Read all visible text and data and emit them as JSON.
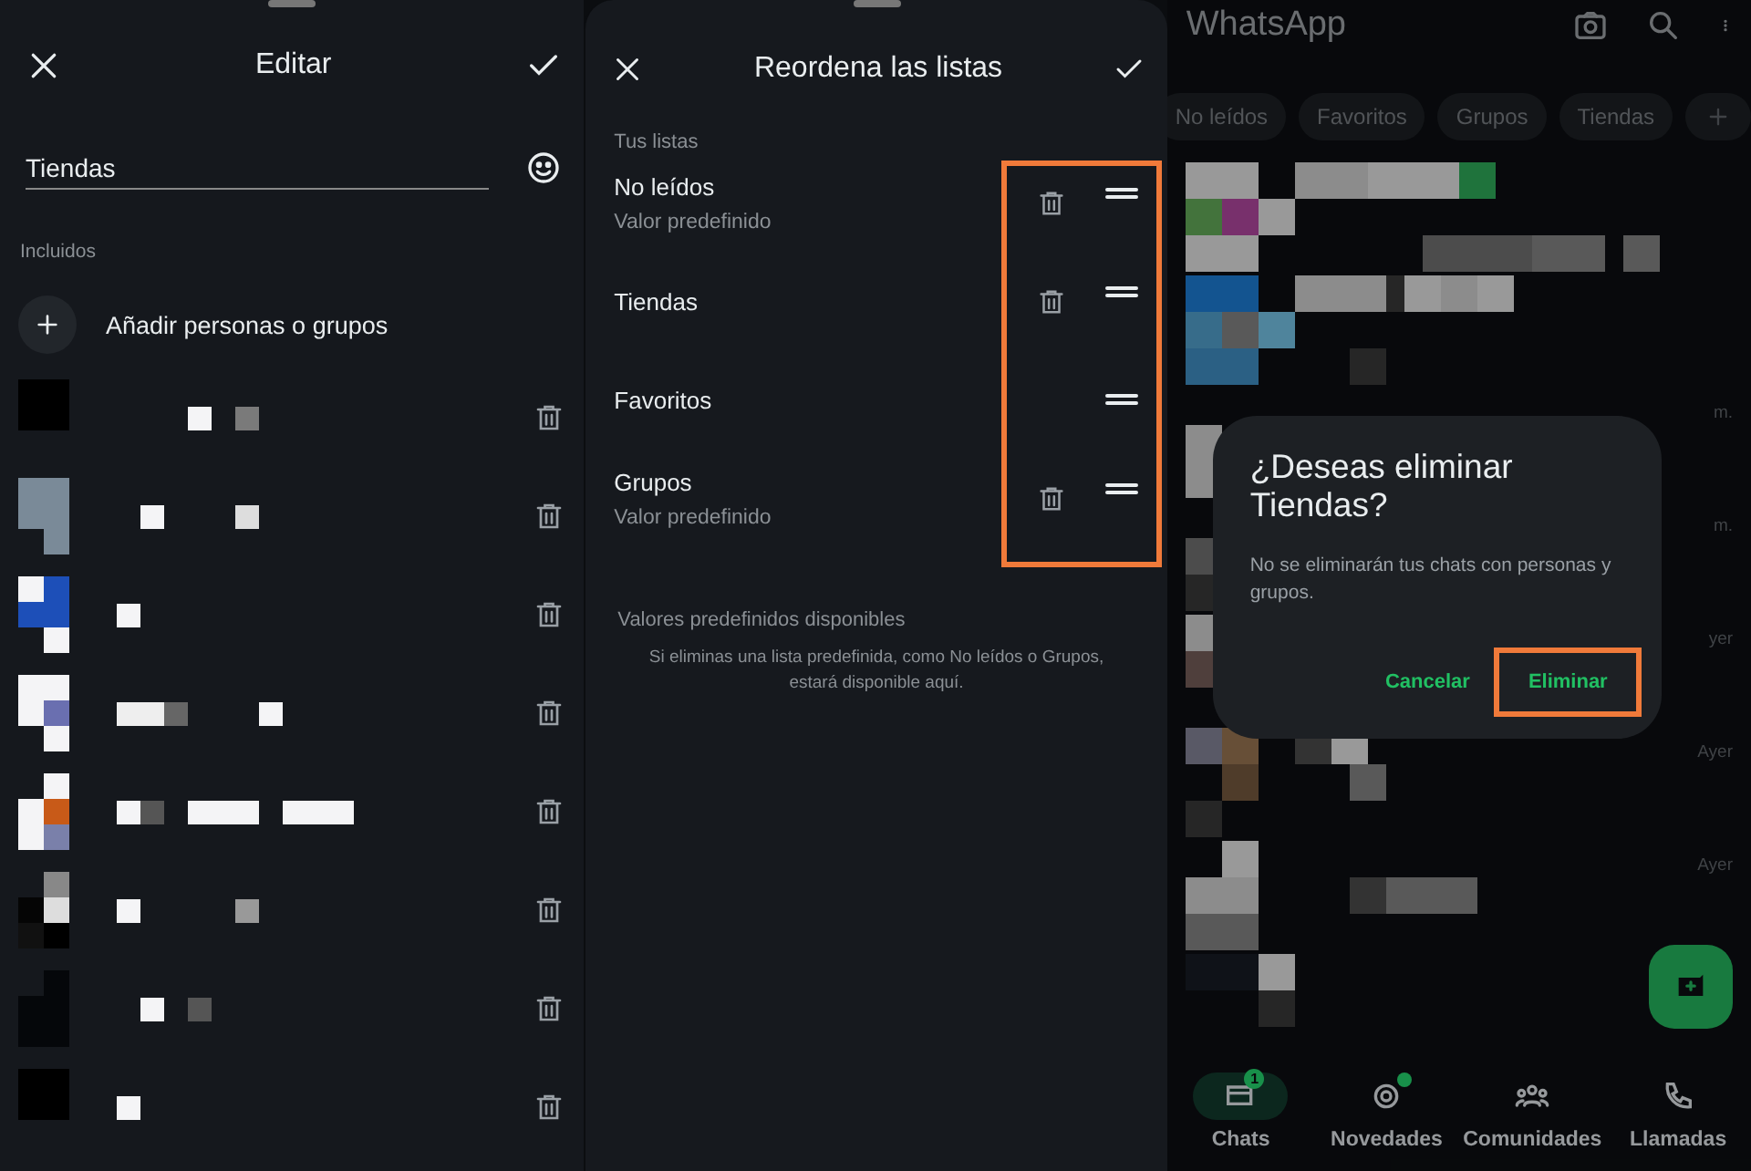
{
  "edit_panel": {
    "title": "Editar",
    "name_field": {
      "value": "Tiendas"
    },
    "section_label": "Incluidos",
    "add_action": "Añadir personas o grupos",
    "members": [
      {
        "kind": "redacted"
      },
      {
        "kind": "redacted"
      },
      {
        "kind": "redacted"
      },
      {
        "kind": "redacted"
      },
      {
        "kind": "redacted"
      },
      {
        "kind": "redacted"
      },
      {
        "kind": "redacted"
      },
      {
        "kind": "redacted"
      }
    ]
  },
  "reorder_panel": {
    "title": "Reordena las listas",
    "section_label": "Tus listas",
    "actions_highlighted": true,
    "lists": [
      {
        "name": "No leídos",
        "subtitle": "Valor predefinido",
        "deletable": true
      },
      {
        "name": "Tiendas",
        "deletable": true
      },
      {
        "name": "Favoritos",
        "deletable": false
      },
      {
        "name": "Grupos",
        "subtitle": "Valor predefinido",
        "deletable": true
      }
    ],
    "available_label": "Valores predefinidos disponibles",
    "available_note": "Si eliminas una lista predefinida, como No leídos o Grupos, estará disponible aquí."
  },
  "chats_screen": {
    "title": "WhatsApp",
    "filters": [
      {
        "label": "No leídos",
        "selected": false
      },
      {
        "label": "Favoritos",
        "selected": false
      },
      {
        "label": "Grupos",
        "selected": false
      },
      {
        "label": "Tiendas",
        "selected": false
      }
    ],
    "chats": [
      {
        "kind": "redacted"
      },
      {
        "kind": "redacted"
      },
      {
        "kind": "redacted",
        "time": "m."
      },
      {
        "kind": "redacted",
        "time": "m."
      },
      {
        "kind": "redacted",
        "time": "yer"
      },
      {
        "kind": "redacted",
        "time": "Ayer"
      },
      {
        "kind": "redacted",
        "time": "Ayer"
      },
      {
        "kind": "redacted"
      }
    ],
    "dialog": {
      "title": "¿Deseas eliminar Tiendas?",
      "message": "No se eliminarán tus chats con personas y grupos.",
      "buttons": [
        {
          "label": "Cancelar",
          "highlighted": false
        },
        {
          "label": "Eliminar",
          "highlighted": true
        }
      ]
    },
    "nav": [
      {
        "label": "Chats",
        "selected": true,
        "badge": "1"
      },
      {
        "label": "Novedades",
        "selected": false,
        "dot": true
      },
      {
        "label": "Comunidades",
        "selected": false
      },
      {
        "label": "Llamadas",
        "selected": false
      }
    ]
  }
}
